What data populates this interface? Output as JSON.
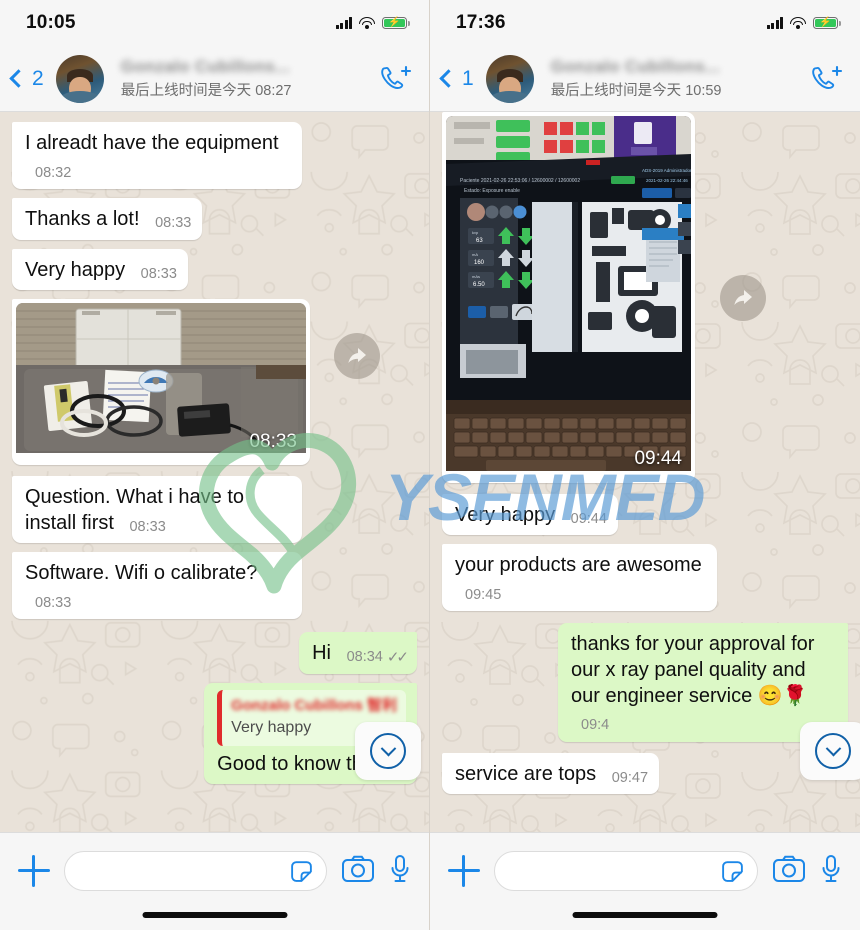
{
  "app": {
    "name": "WhatsApp",
    "watermark_text": "YSENMED",
    "watermark_green": "#76c18a",
    "watermark_blue": "#5b9bd5"
  },
  "panels": [
    {
      "id": "left",
      "statusbar": {
        "time": "10:05",
        "signal_icon": "cellular-signal-icon",
        "wifi_icon": "wifi-icon",
        "battery_icon": "battery-charging-icon"
      },
      "header": {
        "back_icon": "back-chevron-icon",
        "unread_count": "2",
        "avatar": "contact-avatar",
        "contact_name": "Gonzalo Cubillons...",
        "status": "最后上线时间是今天 08:27",
        "call_icon": "add-call-icon"
      },
      "messages": [
        {
          "kind": "text",
          "dir": "in",
          "text": "I alreadt have the equipment",
          "time": "08:32"
        },
        {
          "kind": "text",
          "dir": "in",
          "text": "Thanks a lot!",
          "time": "08:33"
        },
        {
          "kind": "text",
          "dir": "in",
          "text": "Very happy",
          "time": "08:33"
        },
        {
          "kind": "image",
          "dir": "in",
          "caption": "flat-panel-detector-unboxing-photo",
          "time": "08:33",
          "forward_icon": "forward-arrow-icon"
        },
        {
          "kind": "text",
          "dir": "in",
          "text": "Question. What i have to install first",
          "time": "08:33"
        },
        {
          "kind": "text",
          "dir": "in",
          "text": "Software. Wifi o calibrate?",
          "time": "08:33"
        },
        {
          "kind": "text",
          "dir": "out",
          "text": "Hi",
          "time": "08:34",
          "ticks": "✓✓"
        },
        {
          "kind": "quote",
          "dir": "out",
          "quote_name": "Gonzalo Cubillons 智利",
          "quote_text": "Very happy",
          "text": "Good to know that",
          "time": ""
        }
      ],
      "scroll_button": {
        "icon": "chevron-down-circle-icon"
      },
      "inputbar": {
        "plus_icon": "attach-plus-icon",
        "input_value": "",
        "input_placeholder": "",
        "sticker_icon": "sticker-icon",
        "camera_icon": "camera-icon",
        "mic_icon": "microphone-icon"
      }
    },
    {
      "id": "right",
      "statusbar": {
        "time": "17:36",
        "signal_icon": "cellular-signal-icon",
        "wifi_icon": "wifi-icon",
        "battery_icon": "battery-charging-icon"
      },
      "header": {
        "back_icon": "back-chevron-icon",
        "unread_count": "1",
        "avatar": "contact-avatar",
        "contact_name": "Gonzalo Cubillons...",
        "status": "最后上线时间是今天 10:59",
        "call_icon": "add-call-icon"
      },
      "messages": [
        {
          "kind": "image",
          "dir": "in",
          "caption": "laptop-xray-imaging-software-photo",
          "time": "09:44",
          "forward_icon": "forward-arrow-icon"
        },
        {
          "kind": "text",
          "dir": "in",
          "text": "Very happy",
          "time": "09:44"
        },
        {
          "kind": "text",
          "dir": "in",
          "text": "your products are awesome",
          "time": "09:45"
        },
        {
          "kind": "text",
          "dir": "out",
          "text": "thanks for your approval for our x ray panel quality and our engineer service 😊🌹",
          "time": "09:4"
        },
        {
          "kind": "text",
          "dir": "in",
          "text": "service are tops",
          "time": "09:47"
        }
      ],
      "scroll_button": {
        "icon": "chevron-down-circle-icon"
      },
      "inputbar": {
        "plus_icon": "attach-plus-icon",
        "input_value": "",
        "input_placeholder": "",
        "sticker_icon": "sticker-icon",
        "camera_icon": "camera-icon",
        "mic_icon": "microphone-icon"
      }
    }
  ]
}
